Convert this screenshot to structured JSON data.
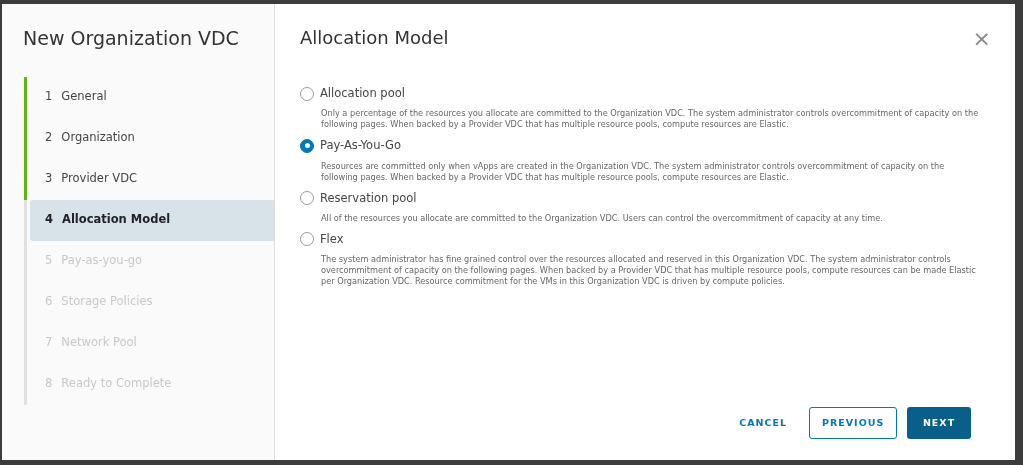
{
  "wizard": {
    "title": "New Organization VDC",
    "steps": [
      {
        "number": "1",
        "label": "General",
        "completed": true,
        "selected": false,
        "disabled": false
      },
      {
        "number": "2",
        "label": "Organization",
        "completed": true,
        "selected": false,
        "disabled": false
      },
      {
        "number": "3",
        "label": "Provider VDC",
        "completed": true,
        "selected": false,
        "disabled": false
      },
      {
        "number": "4",
        "label": "Allocation Model",
        "completed": false,
        "selected": true,
        "disabled": false
      },
      {
        "number": "5",
        "label": "Pay-as-you-go",
        "completed": false,
        "selected": false,
        "disabled": true
      },
      {
        "number": "6",
        "label": "Storage Policies",
        "completed": false,
        "selected": false,
        "disabled": true
      },
      {
        "number": "7",
        "label": "Network Pool",
        "completed": false,
        "selected": false,
        "disabled": true
      },
      {
        "number": "8",
        "label": "Ready to Complete",
        "completed": false,
        "selected": false,
        "disabled": true
      }
    ]
  },
  "page": {
    "title": "Allocation Model",
    "close": "×",
    "options": [
      {
        "label": "Allocation pool",
        "selected": false,
        "description": "Only a percentage of the resources you allocate are committed to the Organization VDC. The system administrator controls overcommitment of capacity on the following pages. When backed by a Provider VDC that has multiple resource pools, compute resources are Elastic."
      },
      {
        "label": "Pay-As-You-Go",
        "selected": true,
        "description": "Resources are committed only when vApps are created in the Organization VDC. The system administrator controls overcommitment of capacity on the following pages. When backed by a Provider VDC that has multiple resource pools, compute resources are Elastic."
      },
      {
        "label": "Reservation pool",
        "selected": false,
        "description": "All of the resources you allocate are committed to the Organization VDC. Users can control the overcommitment of capacity at any time."
      },
      {
        "label": "Flex",
        "selected": false,
        "description": "The system administrator has fine grained control over the resources allocated and reserved in this Organization VDC. The system administrator controls overcommitment of capacity on the following pages. When backed by a Provider VDC that has multiple resource pools, compute resources can be made Elastic per Organization VDC. Resource commitment for the VMs in this Organization VDC is driven by compute policies."
      }
    ],
    "buttons": [
      {
        "kind": "link",
        "label": "CANCEL"
      },
      {
        "kind": "outline",
        "label": "PREVIOUS"
      },
      {
        "kind": "primary",
        "label": "NEXT"
      }
    ]
  }
}
